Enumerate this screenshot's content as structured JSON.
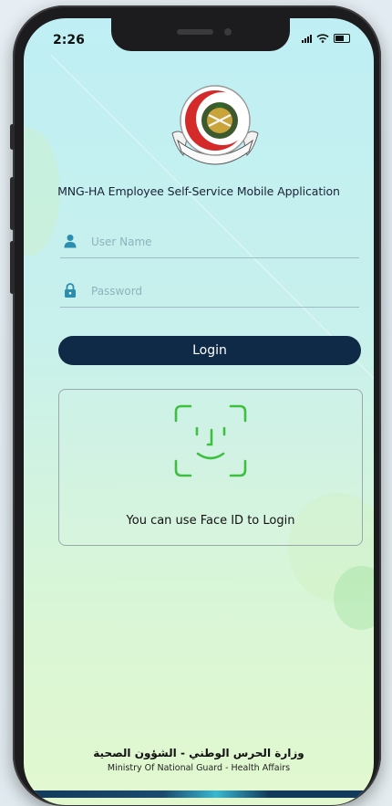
{
  "status_bar": {
    "time": "2:26"
  },
  "app": {
    "title": "MNG-HA Employee Self-Service Mobile Application",
    "logo_icon": "mngha-emblem-logo"
  },
  "form": {
    "username_placeholder": "User Name",
    "password_placeholder": "Password",
    "login_label": "Login"
  },
  "face_id": {
    "icon": "face-id-icon",
    "text": "You can use Face ID to Login"
  },
  "footer": {
    "arabic": "وزارة الحرس الوطني - الشؤون الصحية",
    "english": "Ministry Of National Guard - Health Affairs"
  },
  "colors": {
    "button": "#0f2a47",
    "accent_icon": "#2a8fae",
    "faceid_green": "#3fbf3f"
  }
}
